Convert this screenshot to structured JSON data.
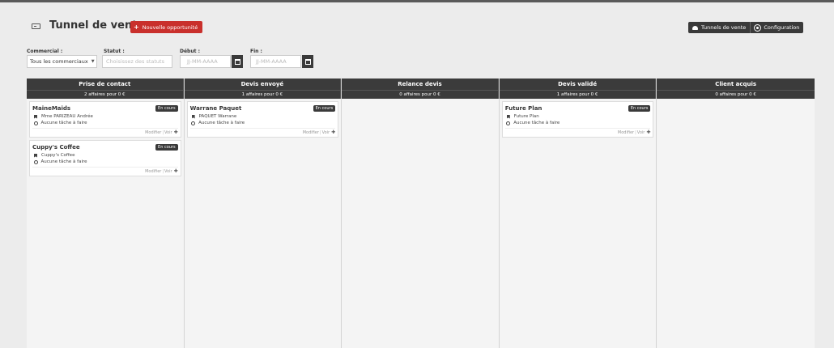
{
  "header": {
    "title": "Tunnel de vente",
    "new_button": "Nouvelle opportunité",
    "tunnels_button": "Tunnels de vente",
    "config_button": "Configuration"
  },
  "filters": {
    "commercial": {
      "label": "Commercial :",
      "value": "Tous les commerciaux"
    },
    "statut": {
      "label": "Statut :",
      "placeholder": "Choisissez des statuts"
    },
    "debut": {
      "label": "Début :",
      "placeholder": "JJ-MM-AAAA"
    },
    "fin": {
      "label": "Fin :",
      "placeholder": "JJ-MM-AAAA"
    }
  },
  "columns": [
    {
      "name": "Prise de contact",
      "summary": "2 affaires pour 0 €",
      "cards": [
        {
          "title": "MaineMaids",
          "status": "En cours",
          "contact": "Mme PARIZEAU Andrée",
          "tasks": "Aucune tâche à faire",
          "edit": "Modifier",
          "view": "Voir"
        },
        {
          "title": "Cuppy's Coffee",
          "status": "En cours",
          "contact": "Cuppy's Coffee",
          "tasks": "Aucune tâche à faire",
          "edit": "Modifier",
          "view": "Voir"
        }
      ]
    },
    {
      "name": "Devis envoyé",
      "summary": "1 affaires pour 0 €",
      "cards": [
        {
          "title": "Warrane Paquet",
          "status": "En cours",
          "contact": "PAQUET Warrane",
          "tasks": "Aucune tâche à faire",
          "edit": "Modifier",
          "view": "Voir"
        }
      ]
    },
    {
      "name": "Relance devis",
      "summary": "0 affaires pour 0 €",
      "cards": []
    },
    {
      "name": "Devis validé",
      "summary": "1 affaires pour 0 €",
      "cards": [
        {
          "title": "Future Plan",
          "status": "En cours",
          "contact": "Future Plan",
          "tasks": "Aucune tâche à faire",
          "edit": "Modifier",
          "view": "Voir"
        }
      ]
    },
    {
      "name": "Client acquis",
      "summary": "0 affaires pour 0 €",
      "cards": []
    }
  ]
}
